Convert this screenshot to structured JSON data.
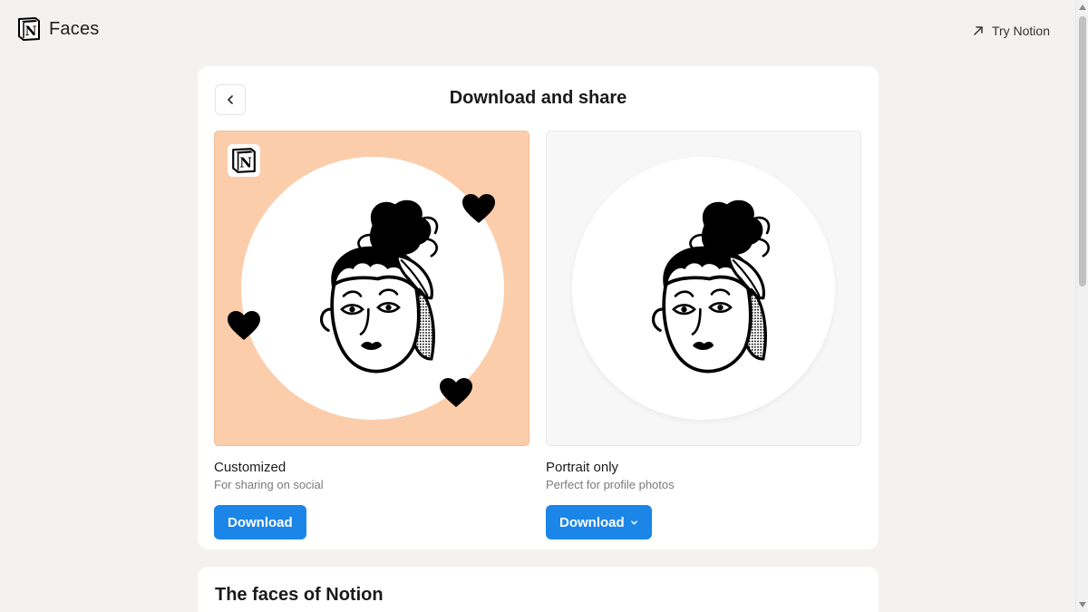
{
  "header": {
    "app_name": "Faces",
    "try_notion_label": "Try Notion",
    "logo_icon": "notion-logo-icon",
    "external_icon": "arrow-up-right-icon"
  },
  "dialog": {
    "title": "Download and share",
    "back_icon": "chevron-left-icon",
    "options": [
      {
        "title": "Customized",
        "subtitle": "For sharing on social",
        "button_label": "Download",
        "background_color": "#fccdab"
      },
      {
        "title": "Portrait only",
        "subtitle": "Perfect for profile photos",
        "button_label": "Download",
        "button_icon": "chevron-down-icon"
      }
    ]
  },
  "section": {
    "title": "The faces of Notion"
  },
  "colors": {
    "accent": "#1b85e8",
    "page_background": "#f3f2f1",
    "card_background": "#ffffff"
  }
}
